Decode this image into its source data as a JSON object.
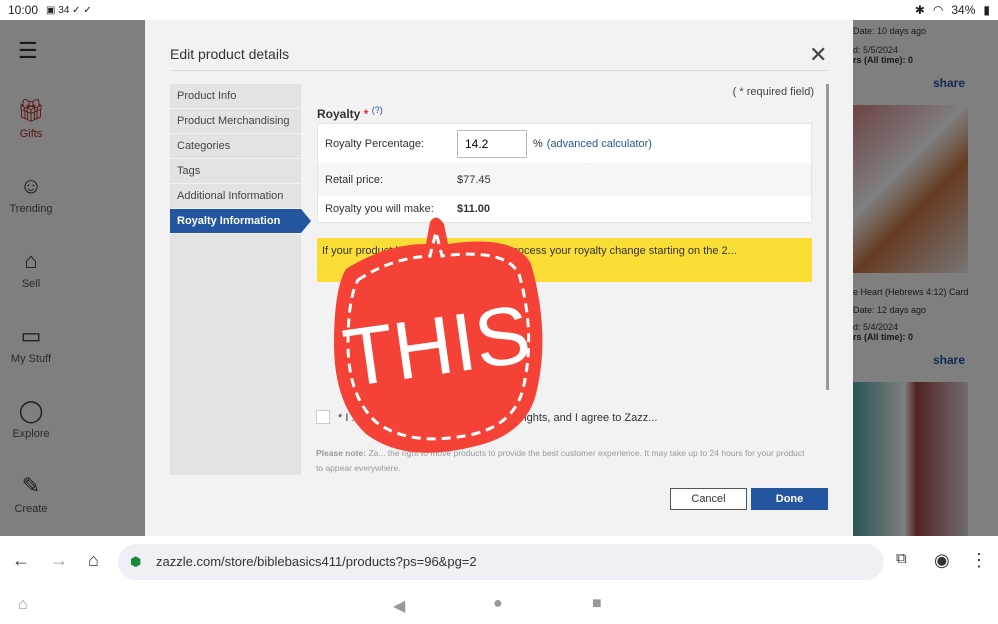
{
  "status": {
    "time": "10:00",
    "icons": [
      "calendar-16",
      "34",
      "check",
      "check"
    ],
    "battery": "34%"
  },
  "sidebar": {
    "items": [
      {
        "label": "Gifts",
        "icon": "gift-icon"
      },
      {
        "label": "Trending",
        "icon": "trending-icon"
      },
      {
        "label": "Sell",
        "icon": "store-icon"
      },
      {
        "label": "My Stuff",
        "icon": "folder-icon"
      },
      {
        "label": "Explore",
        "icon": "bulb-icon"
      },
      {
        "label": "Create",
        "icon": "wand-icon"
      }
    ]
  },
  "background": {
    "lines": [
      "Date: 10 days ago",
      "d: 5/5/2024",
      "rs (All time): 0",
      "share",
      "e Heart (Hebrews 4:12) Card",
      "Date: 12 days ago",
      "d: 5/4/2024",
      "rs (All time): 0",
      "share"
    ]
  },
  "dialog": {
    "title": "Edit product details",
    "menu": [
      "Product Info",
      "Product Merchandising",
      "Categories",
      "Tags",
      "Additional Information",
      "Royalty Information"
    ],
    "required_note": "( * required field)",
    "section_title": "Royalty",
    "help": "(?)",
    "royalty_label": "Royalty Percentage:",
    "royalty_value": "14.2",
    "percent": "%",
    "calculator": "(advanced calculator)",
    "retail_label": "Retail price:",
    "retail_value": "$77.45",
    "make_label": "Royalty you will make:",
    "make_value": "$11.00",
    "banner": "If your product ha... 4 hours ago, we'll process your royalty change starting on the 2...",
    "agree": "* I ... product without violating others' rights, and I agree to Zazz...",
    "note_bold": "Please note:",
    "note": " Za... the right to move products to provide the best customer experience. It may take up to 24 hours for your product to appear everywhere.",
    "cancel": "Cancel",
    "done": "Done"
  },
  "sticker": {
    "text": "THIS",
    "color": "#f44336"
  },
  "browser": {
    "url": "zazzle.com/store/biblebasics411/products?ps=96&pg=2"
  },
  "colors": {
    "accent": "#24559f",
    "banner": "#fbdd38"
  }
}
